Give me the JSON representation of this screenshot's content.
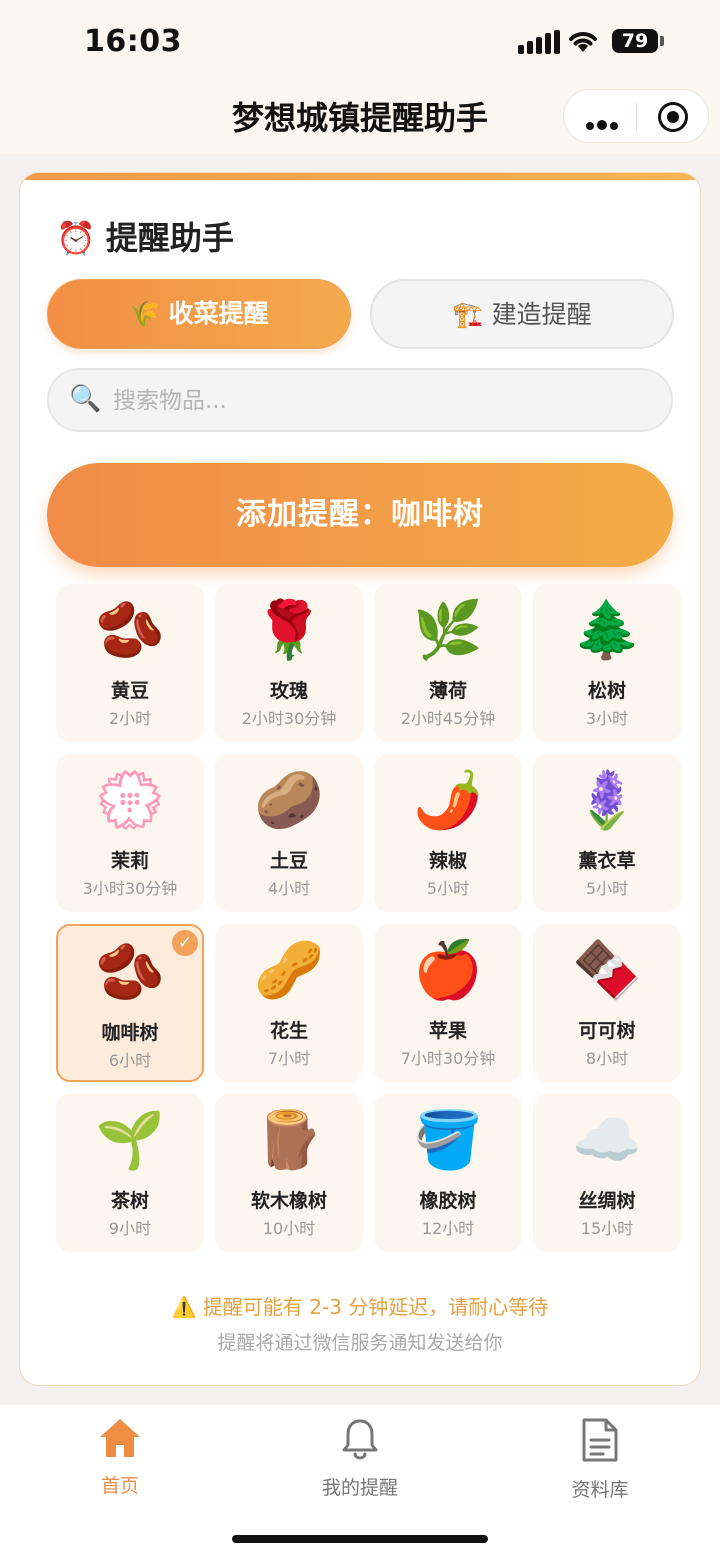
{
  "status": {
    "time": "16:03",
    "battery": "79"
  },
  "header": {
    "title": "梦想城镇提醒助手"
  },
  "card": {
    "title_icon": "⏰",
    "title": "提醒助手",
    "tabs": [
      {
        "icon": "🌾",
        "label": "收菜提醒",
        "active": true
      },
      {
        "icon": "🏗️",
        "label": "建造提醒",
        "active": false
      }
    ],
    "search": {
      "icon": "🔍",
      "placeholder": "搜索物品...",
      "value": ""
    },
    "add_button": "添加提醒：咖啡树",
    "items": [
      {
        "emoji": "🫘",
        "name": "黄豆",
        "duration": "2小时"
      },
      {
        "emoji": "🌹",
        "name": "玫瑰",
        "duration": "2小时30分钟"
      },
      {
        "emoji": "🌿",
        "name": "薄荷",
        "duration": "2小时45分钟"
      },
      {
        "emoji": "🌲",
        "name": "松树",
        "duration": "3小时"
      },
      {
        "emoji": "💮",
        "name": "茉莉",
        "duration": "3小时30分钟"
      },
      {
        "emoji": "🥔",
        "name": "土豆",
        "duration": "4小时"
      },
      {
        "emoji": "🌶️",
        "name": "辣椒",
        "duration": "5小时"
      },
      {
        "emoji": "🪻",
        "name": "薰衣草",
        "duration": "5小时"
      },
      {
        "emoji": "🫘",
        "name": "咖啡树",
        "duration": "6小时",
        "selected": true
      },
      {
        "emoji": "🥜",
        "name": "花生",
        "duration": "7小时"
      },
      {
        "emoji": "🍎",
        "name": "苹果",
        "duration": "7小时30分钟"
      },
      {
        "emoji": "🍫",
        "name": "可可树",
        "duration": "8小时"
      },
      {
        "emoji": "🌱",
        "name": "茶树",
        "duration": "9小时"
      },
      {
        "emoji": "🪵",
        "name": "软木橡树",
        "duration": "10小时"
      },
      {
        "emoji": "🪣",
        "name": "橡胶树",
        "duration": "12小时"
      },
      {
        "emoji": "☁️",
        "name": "丝绸树",
        "duration": "15小时"
      }
    ],
    "warning": "⚠️ 提醒可能有 2-3 分钟延迟，请耐心等待",
    "note": "提醒将通过微信服务通知发送给你"
  },
  "nav": [
    {
      "label": "首页",
      "icon": "home-icon",
      "active": true
    },
    {
      "label": "我的提醒",
      "icon": "bell-icon",
      "active": false
    },
    {
      "label": "资料库",
      "icon": "document-icon",
      "active": false
    }
  ],
  "colors": {
    "accent": "#f09a4a",
    "accent_light": "#fdf6ee",
    "selected_border": "#f2a25a"
  }
}
